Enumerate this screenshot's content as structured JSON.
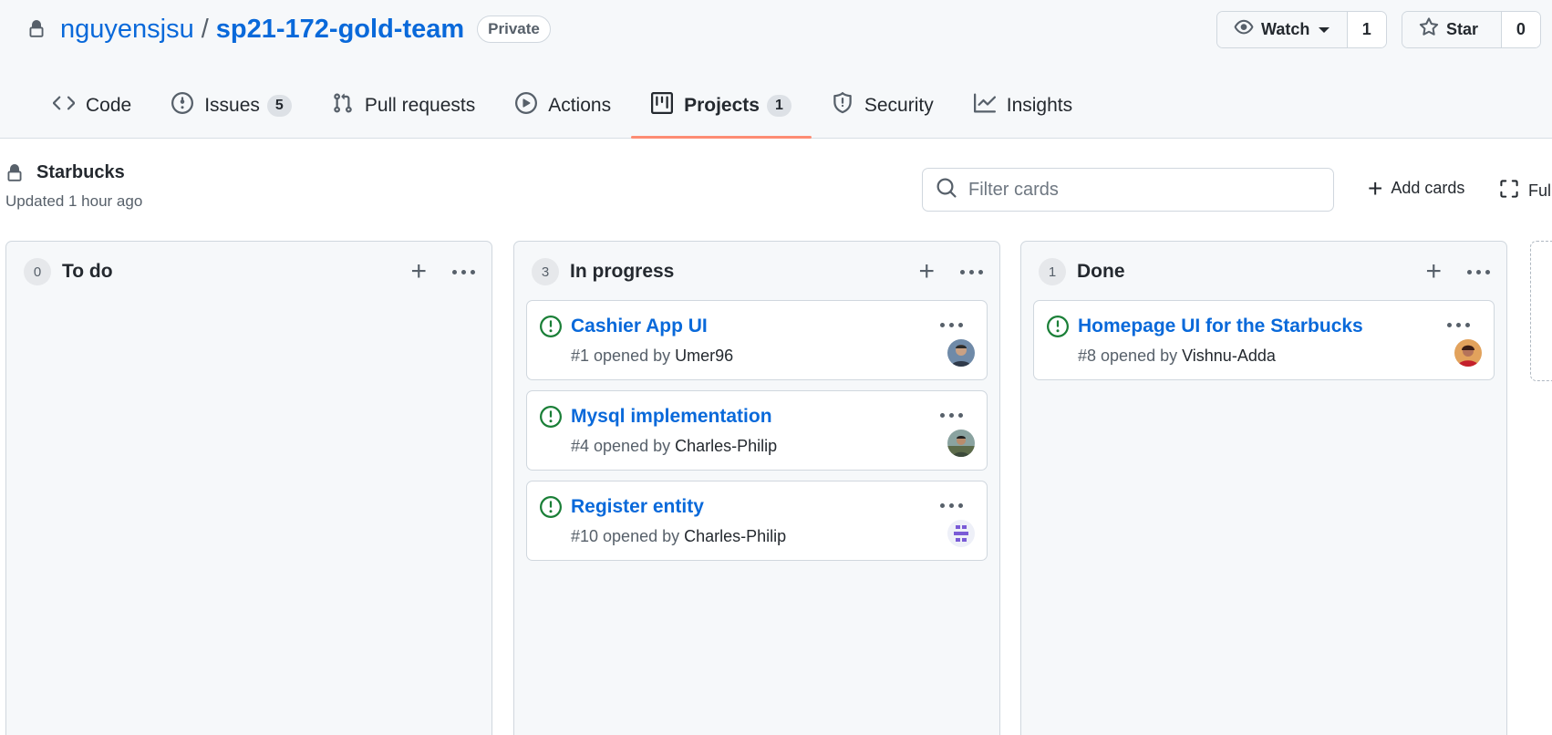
{
  "repo": {
    "owner": "nguyensjsu",
    "separator": "/",
    "name": "sp21-172-gold-team",
    "visibility": "Private"
  },
  "actions": {
    "watch_label": "Watch",
    "watch_count": "1",
    "star_label": "Star",
    "star_count": "0"
  },
  "tabs": [
    {
      "label": "Code",
      "icon": "code-icon"
    },
    {
      "label": "Issues",
      "icon": "issue-icon",
      "counter": "5"
    },
    {
      "label": "Pull requests",
      "icon": "pull-request-icon"
    },
    {
      "label": "Actions",
      "icon": "play-icon"
    },
    {
      "label": "Projects",
      "icon": "project-icon",
      "counter": "1",
      "active": true
    },
    {
      "label": "Security",
      "icon": "shield-icon"
    },
    {
      "label": "Insights",
      "icon": "graph-icon"
    }
  ],
  "project": {
    "name": "Starbucks",
    "updated": "Updated 1 hour ago",
    "filter_placeholder": "Filter cards",
    "add_cards_label": "Add cards",
    "fullscreen_label": "Full"
  },
  "columns": [
    {
      "count": "0",
      "title": "To do",
      "cards": []
    },
    {
      "count": "3",
      "title": "In progress",
      "cards": [
        {
          "title": "Cashier App UI",
          "meta": "#1 opened by ",
          "author": "Umer96"
        },
        {
          "title": "Mysql implementation",
          "meta": "#4 opened by ",
          "author": "Charles-Philip"
        },
        {
          "title": "Register entity",
          "meta": "#10 opened by ",
          "author": "Charles-Philip"
        }
      ]
    },
    {
      "count": "1",
      "title": "Done",
      "cards": [
        {
          "title": "Homepage UI for the Starbucks",
          "meta": "#8 opened by ",
          "author": "Vishnu-Adda"
        }
      ]
    }
  ],
  "colors": {
    "link": "#0969da",
    "open_issue": "#1a7f37",
    "active_tab_underline": "#fd8c73"
  }
}
